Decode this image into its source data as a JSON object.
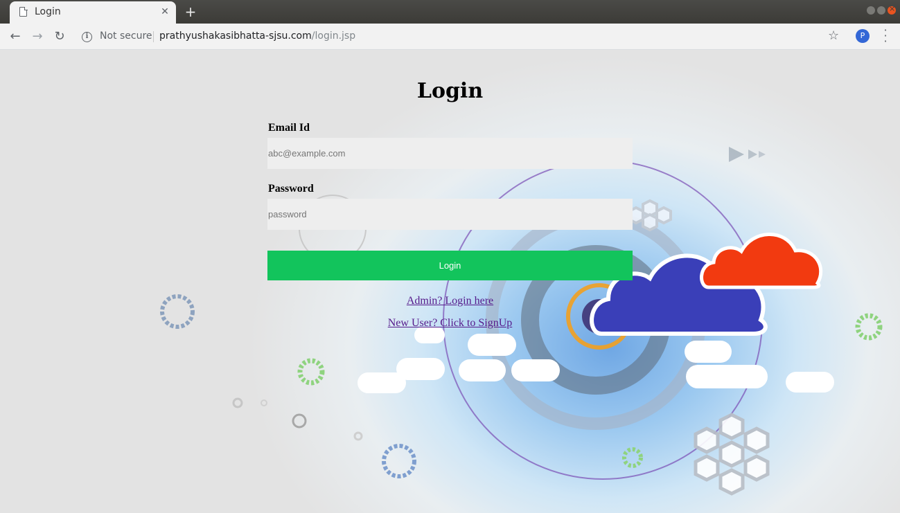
{
  "browser": {
    "tab_title": "Login",
    "new_tab_symbol": "+",
    "address": {
      "security_label": "Not secure",
      "host": "prathyushakasibhatta-sjsu.com",
      "path": "/login.jsp"
    },
    "profile_initial": "P"
  },
  "form": {
    "heading": "Login",
    "email": {
      "label": "Email Id",
      "placeholder": "abc@example.com",
      "value": ""
    },
    "password": {
      "label": "Password",
      "placeholder": "password",
      "value": ""
    },
    "submit_label": "Login",
    "admin_link": "Admin? Login here",
    "signup_link": "New User? Click to SignUp"
  },
  "colors": {
    "login_button": "#12c45c",
    "visited_link": "#551a8b",
    "input_background": "#eeeeee",
    "cloud_blue": "#3a3fb8",
    "cloud_red": "#f23a10"
  },
  "icons": [
    "page-icon",
    "close-icon",
    "plus-icon",
    "back-arrow-icon",
    "forward-arrow-icon",
    "reload-icon",
    "info-icon",
    "star-icon",
    "kebab-menu-icon"
  ]
}
